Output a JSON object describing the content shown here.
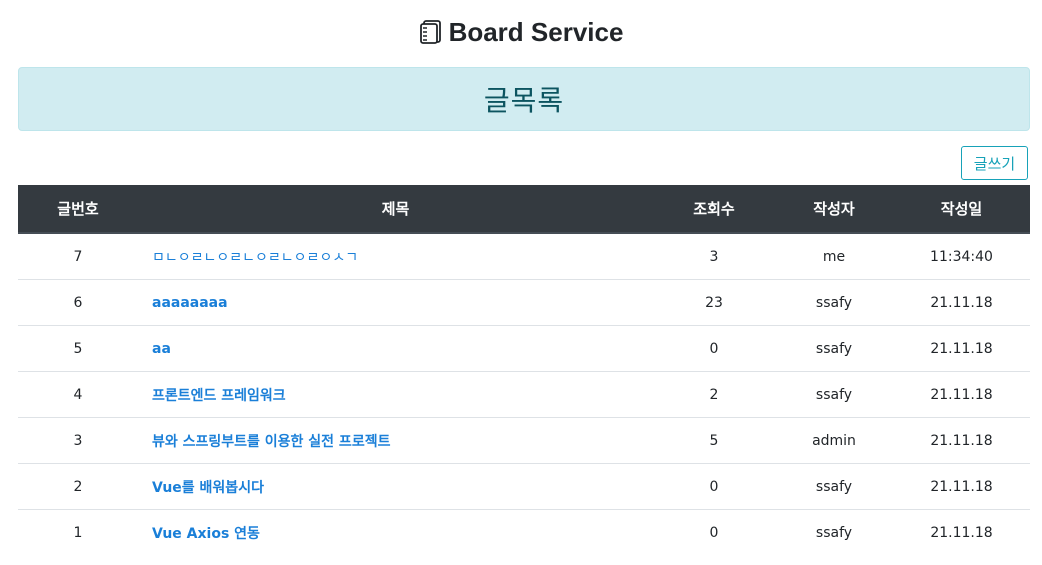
{
  "header": {
    "brand_icon": "notebook-icon",
    "brand_title": "Board Service"
  },
  "banner": {
    "title": "글목록"
  },
  "toolbar": {
    "write_label": "글쓰기"
  },
  "table": {
    "columns": [
      "글번호",
      "제목",
      "조회수",
      "작성자",
      "작성일"
    ],
    "rows": [
      {
        "no": "7",
        "title": "ㅁㄴㅇㄹㄴㅇㄹㄴㅇㄹㄴㅇㄹㅇㅅㄱ",
        "views": "3",
        "author": "me",
        "date": "11:34:40"
      },
      {
        "no": "6",
        "title": "aaaaaaaa",
        "views": "23",
        "author": "ssafy",
        "date": "21.11.18"
      },
      {
        "no": "5",
        "title": "aa",
        "views": "0",
        "author": "ssafy",
        "date": "21.11.18"
      },
      {
        "no": "4",
        "title": "프론트엔드 프레임워크",
        "views": "2",
        "author": "ssafy",
        "date": "21.11.18"
      },
      {
        "no": "3",
        "title": "뷰와 스프링부트를 이용한 실전 프로젝트",
        "views": "5",
        "author": "admin",
        "date": "21.11.18"
      },
      {
        "no": "2",
        "title": "Vue를 배워봅시다",
        "views": "0",
        "author": "ssafy",
        "date": "21.11.18"
      },
      {
        "no": "1",
        "title": "Vue Axios 연동",
        "views": "0",
        "author": "ssafy",
        "date": "21.11.18"
      }
    ]
  },
  "colors": {
    "banner_bg": "#d1ecf1",
    "banner_text": "#0c5460",
    "table_header_bg": "#343a40",
    "link": "#1a7fd8",
    "write_button": "#17a2b8",
    "brand_highlight": "#f3b8d8"
  }
}
